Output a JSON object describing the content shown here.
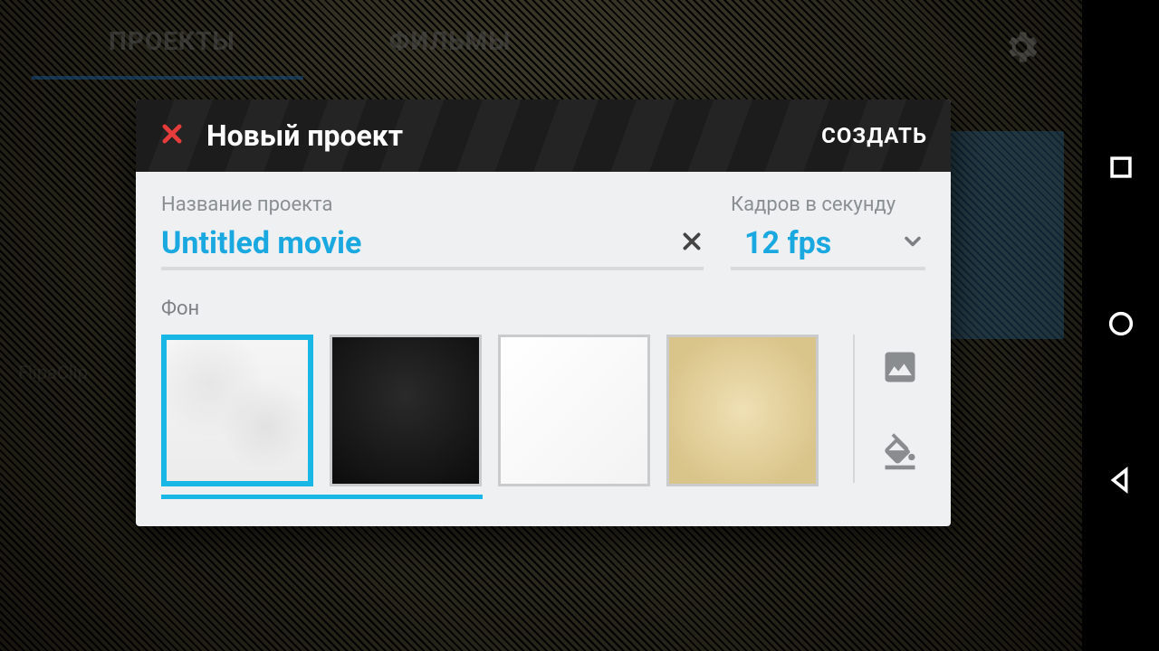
{
  "app": {
    "tabs": {
      "projects": "ПРОЕКТЫ",
      "movies": "ФИЛЬМЫ"
    },
    "bg_label": "FlipaClip"
  },
  "dialog": {
    "title": "Новый проект",
    "create": "СОЗДАТЬ",
    "name_label": "Название проекта",
    "name_value": "Untitled movie",
    "fps_label": "Кадров в секунду",
    "fps_value": "12 fps",
    "background_label": "Фон"
  },
  "backgrounds": [
    {
      "id": "crumpled-paper",
      "selected": true
    },
    {
      "id": "black",
      "selected": false
    },
    {
      "id": "white",
      "selected": false
    },
    {
      "id": "parchment",
      "selected": false
    }
  ]
}
